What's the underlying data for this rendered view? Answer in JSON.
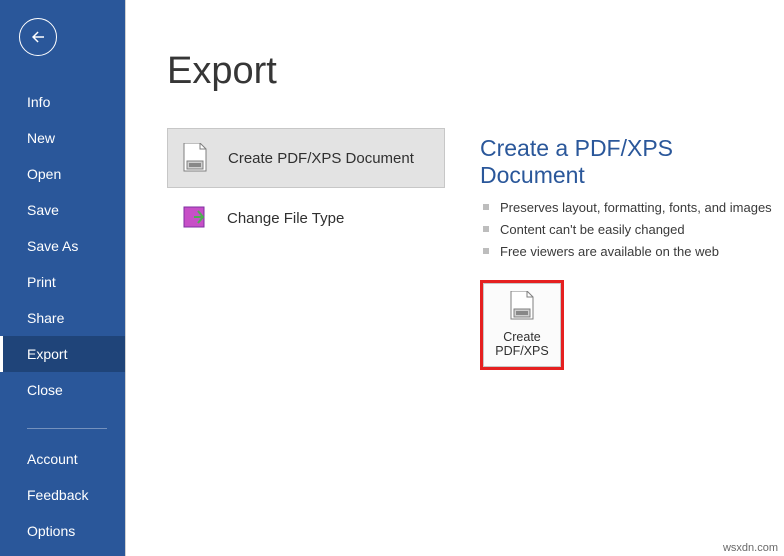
{
  "sidebar": {
    "items": [
      {
        "label": "Info"
      },
      {
        "label": "New"
      },
      {
        "label": "Open"
      },
      {
        "label": "Save"
      },
      {
        "label": "Save As"
      },
      {
        "label": "Print"
      },
      {
        "label": "Share"
      },
      {
        "label": "Export",
        "selected": true
      },
      {
        "label": "Close"
      }
    ],
    "bottom_items": [
      {
        "label": "Account"
      },
      {
        "label": "Feedback"
      },
      {
        "label": "Options"
      }
    ]
  },
  "page": {
    "title": "Export"
  },
  "options": [
    {
      "label": "Create PDF/XPS Document",
      "selected": true,
      "name": "option-create-pdf-xps"
    },
    {
      "label": "Change File Type",
      "selected": false,
      "name": "option-change-file-type"
    }
  ],
  "detail": {
    "title": "Create a PDF/XPS Document",
    "bullets": [
      "Preserves layout, formatting, fonts, and images",
      "Content can't be easily changed",
      "Free viewers are available on the web"
    ],
    "button_line1": "Create",
    "button_line2": "PDF/XPS"
  },
  "watermark": "wsxdn.com",
  "colors": {
    "sidebar_bg": "#2a579a",
    "sidebar_selected": "#1f4479",
    "page_title": "#363636",
    "accent_blue": "#2a579a",
    "highlight_red": "#e52020"
  }
}
